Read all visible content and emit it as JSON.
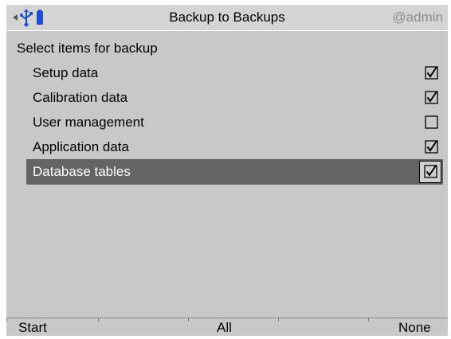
{
  "header": {
    "title": "Backup to Backups",
    "user": "@admin",
    "icons": [
      "back-arrow-icon",
      "usb-icon",
      "battery-icon"
    ]
  },
  "section_title": "Select items for backup",
  "items": [
    {
      "label": "Setup data",
      "checked": true
    },
    {
      "label": "Calibration data",
      "checked": true
    },
    {
      "label": "User management",
      "checked": false
    },
    {
      "label": "Application data",
      "checked": true
    },
    {
      "label": "Database tables",
      "checked": true,
      "selected": true
    }
  ],
  "softkeys": {
    "start": "Start",
    "all": "All",
    "none": "None"
  },
  "colors": {
    "background": "#c8c8c8",
    "selection": "#646464",
    "icon_blue": "#1e4fcf"
  }
}
